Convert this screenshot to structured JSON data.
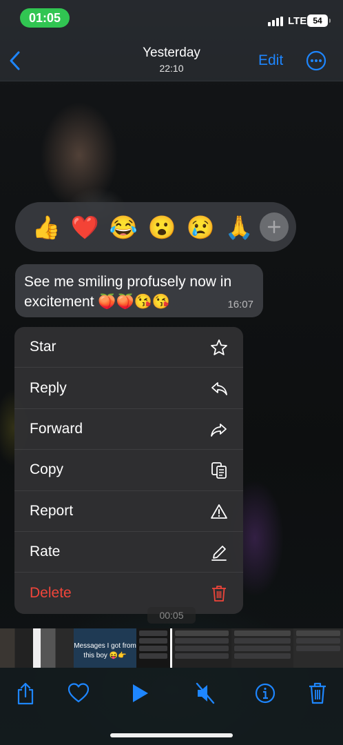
{
  "status_bar": {
    "time": "01:05",
    "network": "LTE",
    "battery": "54"
  },
  "nav": {
    "title": "Yesterday",
    "subtitle": "22:10",
    "edit_label": "Edit"
  },
  "reactions": [
    "👍",
    "❤️",
    "😂",
    "😮",
    "😢",
    "🙏"
  ],
  "message": {
    "text": "See me smiling profusely now in excitement 🍑🍑😘😘",
    "time": "16:07"
  },
  "menu": {
    "items": [
      {
        "label": "Star",
        "icon": "star-icon"
      },
      {
        "label": "Reply",
        "icon": "reply-icon"
      },
      {
        "label": "Forward",
        "icon": "forward-icon"
      },
      {
        "label": "Copy",
        "icon": "copy-icon"
      },
      {
        "label": "Report",
        "icon": "warning-icon"
      },
      {
        "label": "Rate",
        "icon": "pencil-icon"
      },
      {
        "label": "Delete",
        "icon": "trash-icon",
        "color": "#f0453a"
      }
    ]
  },
  "video_time": "00:05",
  "filmstrip": {
    "caption": "Messages I got from this boy 😝👉"
  },
  "colors": {
    "accent": "#1e86ff",
    "danger": "#f0453a",
    "status_green": "#31c552"
  }
}
